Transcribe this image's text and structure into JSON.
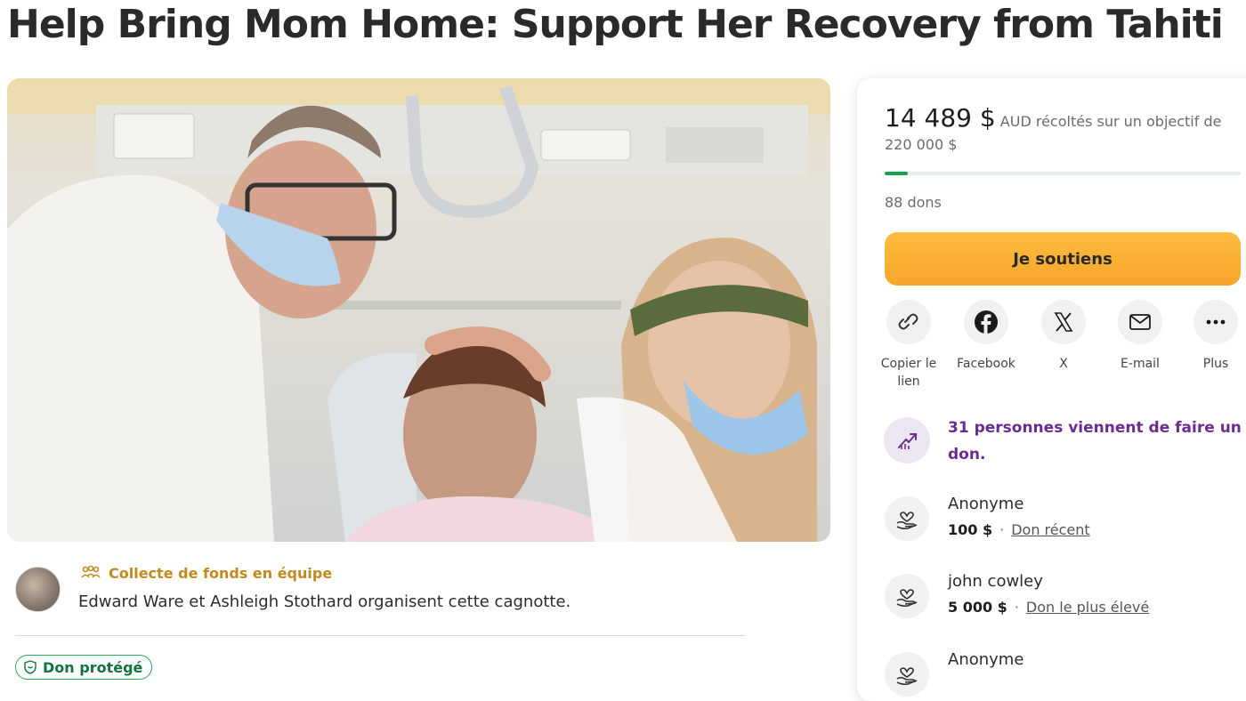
{
  "page": {
    "title": "Help Bring Mom Home: Support Her Recovery from Tahiti"
  },
  "organizer": {
    "team_label": "Collecte de fonds en équipe",
    "text": "Edward Ware et Ashleigh Stothard organisent cette cagnotte.",
    "protected_label": "Don protégé"
  },
  "progress": {
    "raised": "14 489 $",
    "raised_suffix": "AUD récoltés sur un objectif de",
    "goal": "220 000 $",
    "fraction": 0.066,
    "donations": "88 dons"
  },
  "cta": {
    "donate_label": "Je soutiens"
  },
  "share": {
    "items": [
      {
        "label": "Copier le lien",
        "icon": "link-icon"
      },
      {
        "label": "Facebook",
        "icon": "facebook-icon"
      },
      {
        "label": "X",
        "icon": "x-icon"
      },
      {
        "label": "E-mail",
        "icon": "mail-icon"
      },
      {
        "label": "Plus",
        "icon": "more-icon"
      }
    ]
  },
  "recent": {
    "text": "31 personnes viennent de faire un don."
  },
  "donors": [
    {
      "name": "Anonyme",
      "amount": "100 $",
      "tag": "Don récent"
    },
    {
      "name": "john cowley",
      "amount": "5 000 $",
      "tag": "Don le plus élevé"
    },
    {
      "name": "Anonyme",
      "amount": "",
      "tag": ""
    }
  ],
  "colors": {
    "accent_purple": "#6a2c91",
    "progress_green": "#11a34f",
    "button_orange": "#f7a52a",
    "team_gold": "#c28a1e",
    "protected_green": "#2aa95a"
  }
}
